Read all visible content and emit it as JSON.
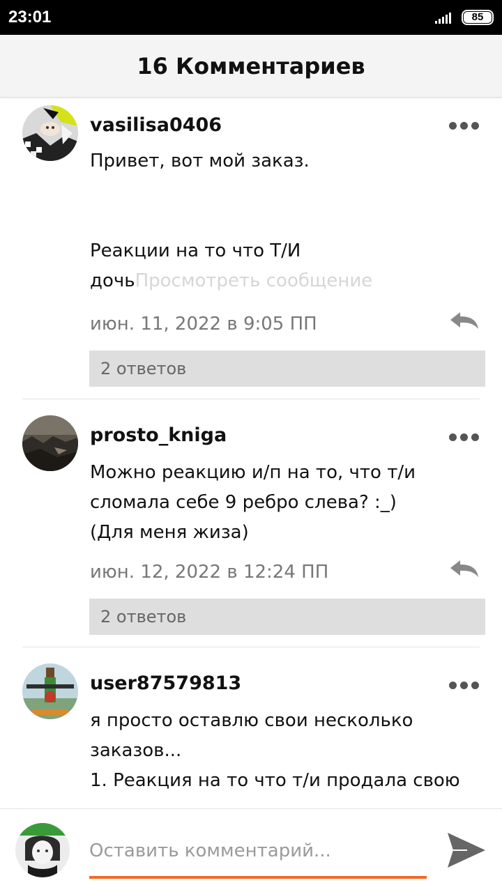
{
  "status_bar": {
    "time": "23:01",
    "battery": "85"
  },
  "header": {
    "title": "16 Комментариев"
  },
  "comments": [
    {
      "username": "vasilisa0406",
      "text": "Привет, вот мой заказ.\n\n\nРеакции на то что Т/И\nдочь",
      "view_more": "Просмотреть сообщение",
      "timestamp": "июн. 11, 2022 в 9:05 ПП",
      "replies": "2 ответов"
    },
    {
      "username": "prosto_kniga",
      "text": "Можно реакцию и/п на то, что т/и\nсломала себе 9 ребро слева? :_)\n(Для меня жиза)",
      "timestamp": "июн. 12, 2022 в 12:24 ПП",
      "replies": "2 ответов"
    },
    {
      "username": "user87579813",
      "text": "я просто оставлю свои несколько\nзаказов...\n1. Реакция на то что т/и продала свою"
    }
  ],
  "composer": {
    "placeholder": "Оставить комментарий..."
  },
  "colors": {
    "accent": "#f26a21",
    "reply_bar": "#dedede",
    "view_more": "#d6d6d6"
  },
  "icons": {
    "more": "more-icon",
    "reply": "reply-icon",
    "send": "send-icon",
    "signal": "signal-icon"
  }
}
